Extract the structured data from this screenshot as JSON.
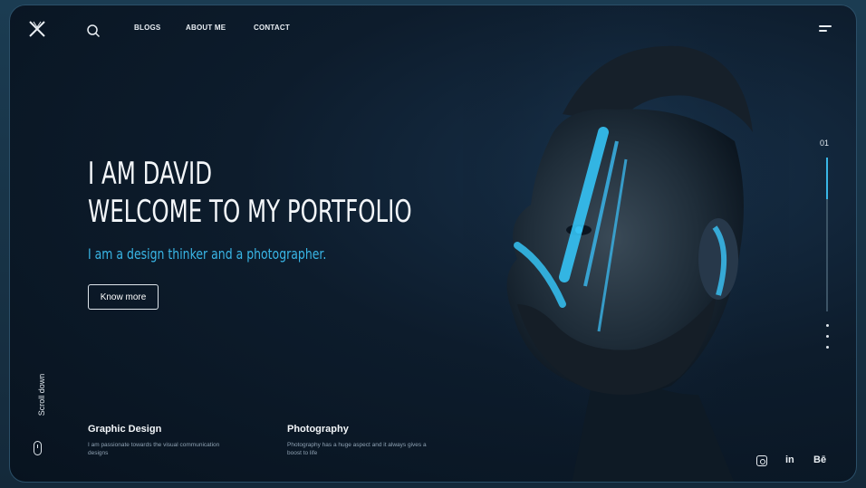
{
  "nav": {
    "items": [
      "BLOGS",
      "ABOUT ME",
      "CONTACT"
    ]
  },
  "hero": {
    "line1": "I AM DAVID",
    "line2": "WELCOME TO MY PORTFOLIO",
    "subtitle": "I am a design thinker and a photographer.",
    "cta": "Know more"
  },
  "features": [
    {
      "title": "Graphic Design",
      "desc": "I am passionate towards the visual communication designs"
    },
    {
      "title": "Photography",
      "desc": "Photography has a huge aspect and it always gives a boost to life"
    }
  ],
  "scroll": {
    "label": "Scroll down"
  },
  "pager": {
    "current": "01",
    "progress": 0.27
  },
  "social": {
    "linkedin": "in",
    "behance": "Bē"
  },
  "colors": {
    "accent": "#39b6e6",
    "background": "#0d1c2c",
    "text": "#f3f6f9"
  },
  "icons": [
    "logo-x-icon",
    "search-icon",
    "menu-icon",
    "mouse-icon",
    "instagram-icon",
    "linkedin-icon",
    "behance-icon"
  ]
}
